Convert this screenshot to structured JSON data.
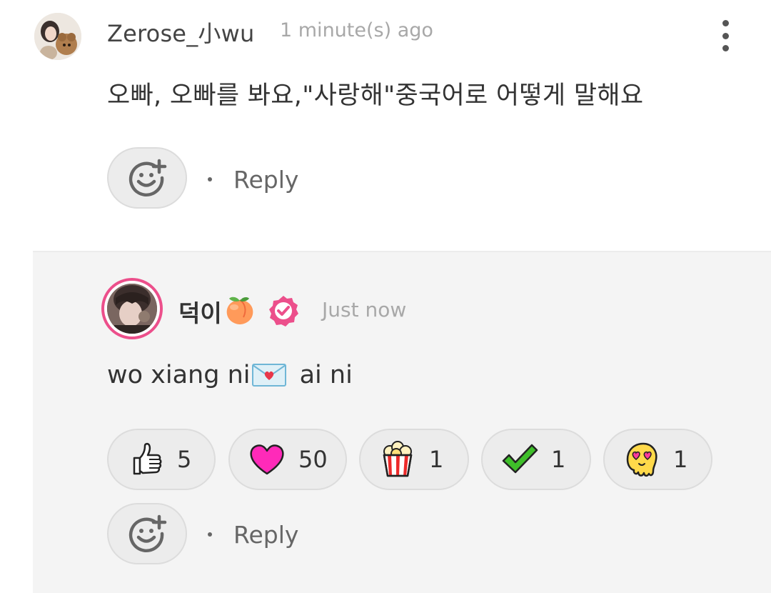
{
  "comment": {
    "username": "Zerose_小wu",
    "timestamp": "1 minute(s) ago",
    "text": "오빠, 오빠를 봐요,\"사랑해\"중국어로 어떻게 말해요",
    "reply_label": "Reply",
    "separator": "·"
  },
  "reply": {
    "username": "덕이",
    "username_emoji": "peach-emoji",
    "verified": true,
    "timestamp": "Just now",
    "text_before": "wo xiang ni",
    "text_emoji": "love-letter-emoji",
    "text_after": " ai ni",
    "reply_label": "Reply",
    "separator": "·",
    "reactions": [
      {
        "icon": "thumbs-up-icon",
        "count": "5"
      },
      {
        "icon": "heart-icon",
        "count": "50"
      },
      {
        "icon": "popcorn-icon",
        "count": "1"
      },
      {
        "icon": "check-icon",
        "count": "1"
      },
      {
        "icon": "heart-eyes-face-icon",
        "count": "1"
      }
    ]
  },
  "colors": {
    "accent_pink": "#ec4f8b",
    "heart": "#ff2ab9",
    "check": "#3fbf2a",
    "face": "#ffd94a"
  }
}
